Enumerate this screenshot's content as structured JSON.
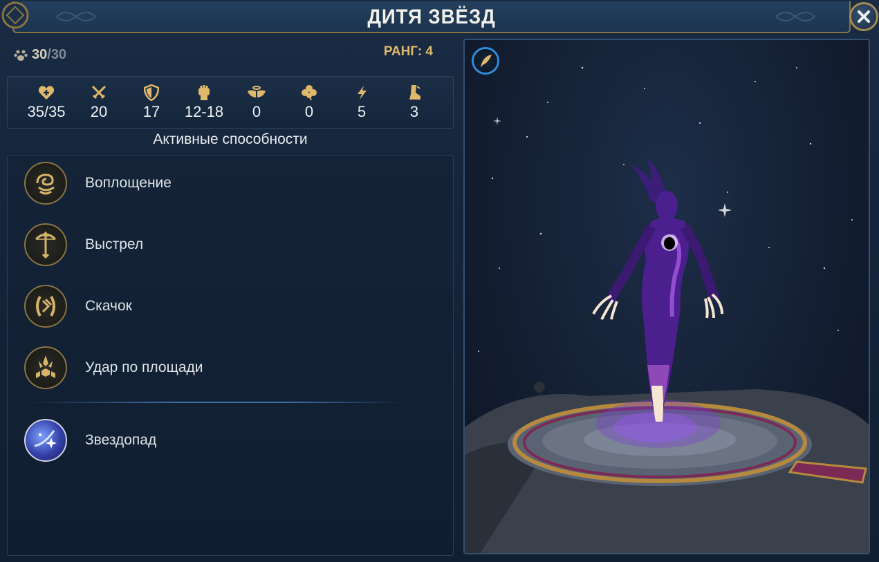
{
  "window": {
    "title": "ДИТЯ ЗВЁЗД",
    "close_label": "×"
  },
  "unit": {
    "squad_current": "30",
    "squad_separator": "/",
    "squad_max": "30",
    "rank_label": "РАНГ: 4"
  },
  "stats": [
    {
      "icon": "health-heart-icon",
      "value": "35/35"
    },
    {
      "icon": "attack-swords-icon",
      "value": "20"
    },
    {
      "icon": "defense-shield-icon",
      "value": "17"
    },
    {
      "icon": "damage-fist-icon",
      "value": "12-18"
    },
    {
      "icon": "morale-wings-icon",
      "value": "0"
    },
    {
      "icon": "luck-clover-icon",
      "value": "0"
    },
    {
      "icon": "initiative-lightning-icon",
      "value": "5"
    },
    {
      "icon": "speed-boot-icon",
      "value": "3"
    }
  ],
  "abilities_section": {
    "title": "Активные способности",
    "items": [
      {
        "icon": "incarnation-icon",
        "name": "Воплощение"
      },
      {
        "icon": "bow-shot-icon",
        "name": "Выстрел"
      },
      {
        "icon": "leap-icon",
        "name": "Скачок"
      },
      {
        "icon": "area-strike-icon",
        "name": "Удар по площади"
      }
    ],
    "spell": {
      "icon": "starfall-icon",
      "name": "Звездопад"
    }
  },
  "colors": {
    "gold": "#e0b86a",
    "frame_gold": "#8a7445",
    "panel_bg": "#14243a",
    "accent_blue": "#2f8ad8"
  }
}
